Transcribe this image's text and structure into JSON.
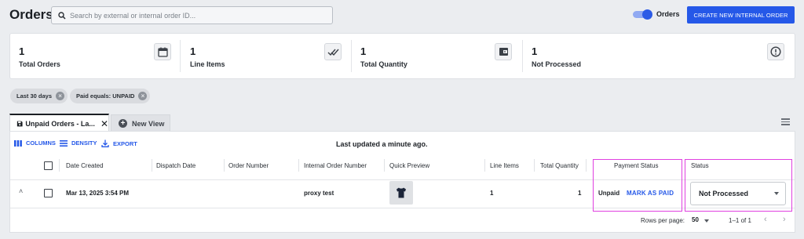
{
  "header": {
    "title": "Orders",
    "search_placeholder": "Search by external or internal order ID...",
    "toggle_label": "Orders",
    "toggle_on": true,
    "create_button": "CREATE NEW INTERNAL ORDER"
  },
  "summary": [
    {
      "value": "1",
      "label": "Total Orders",
      "icon": "calendar-icon"
    },
    {
      "value": "1",
      "label": "Line Items",
      "icon": "double-check-icon"
    },
    {
      "value": "1",
      "label": "Total Quantity",
      "icon": "wallet-icon"
    },
    {
      "value": "1",
      "label": "Not Processed",
      "icon": "alert-circle-icon"
    }
  ],
  "filters": [
    {
      "label": "Last 30 days"
    },
    {
      "label": "Paid equals: UNPAID"
    }
  ],
  "tabs": {
    "active": "Unpaid Orders - La...",
    "new_view": "New View"
  },
  "toolbar": {
    "columns": "COLUMNS",
    "density": "DENSITY",
    "export": "EXPORT",
    "updated": "Last updated a minute ago."
  },
  "table": {
    "headers": {
      "date_created": "Date Created",
      "dispatch_date": "Dispatch Date",
      "order_number": "Order Number",
      "internal_order_number": "Internal Order Number",
      "quick_preview": "Quick Preview",
      "line_items": "Line Items",
      "total_quantity": "Total Quantity",
      "payment_status": "Payment Status",
      "status": "Status"
    },
    "rows": [
      {
        "date_created": "Mar 13, 2025 3:54 PM",
        "dispatch_date": "",
        "order_number": "",
        "internal_order_number": "proxy test",
        "line_items": "1",
        "total_quantity": "1",
        "payment_status": "Unpaid",
        "mark_paid": "MARK AS PAID",
        "status": "Not Processed"
      }
    ]
  },
  "pagination": {
    "rows_per_page_label": "Rows per page:",
    "rows_per_page": "50",
    "range": "1–1 of 1"
  },
  "colors": {
    "accent": "#2558e8",
    "highlight": "#e040e0"
  }
}
